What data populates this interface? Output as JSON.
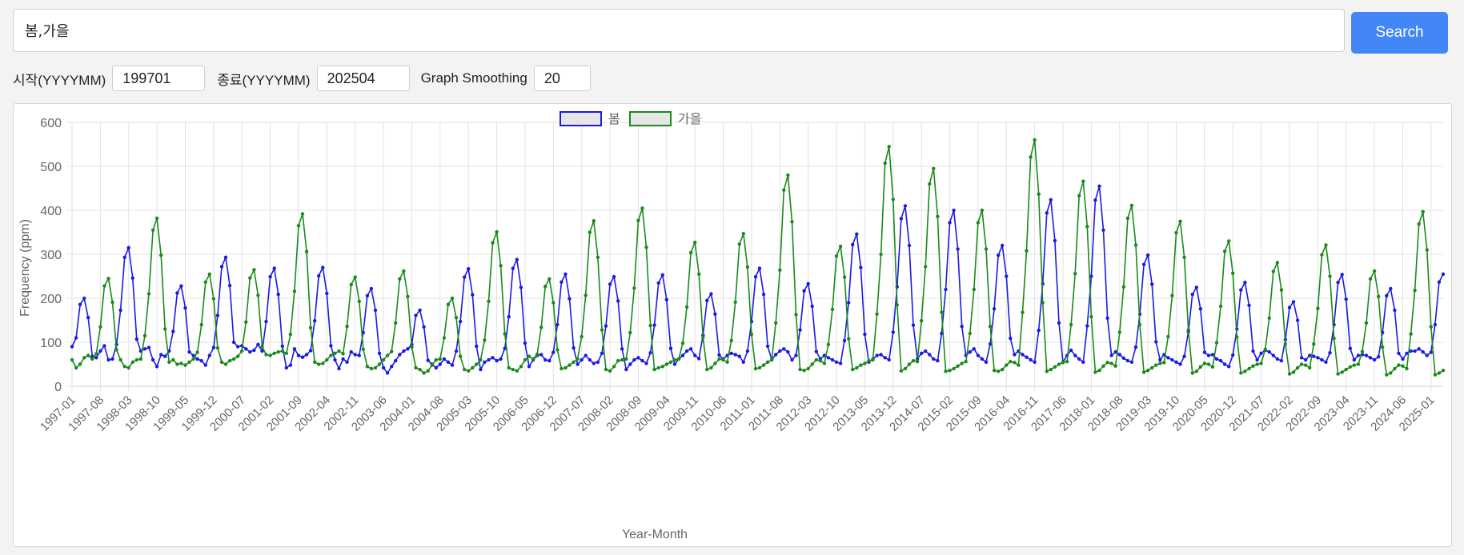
{
  "search": {
    "query": "봄,가을",
    "button_label": "Search"
  },
  "params": {
    "start_label": "시작(YYYYMM)",
    "start_value": "199701",
    "end_label": "종료(YYYYMM)",
    "end_value": "202504",
    "smoothing_label": "Graph Smoothing",
    "smoothing_value": "20"
  },
  "chart_data": {
    "type": "line",
    "xlabel": "Year-Month",
    "ylabel": "Frequency (ppm)",
    "ylim": [
      0,
      600
    ],
    "yticks": [
      0,
      100,
      200,
      300,
      400,
      500,
      600
    ],
    "grid": true,
    "legend_position": "top-center",
    "start": "1997-01",
    "tick_labels": [
      "1997-01",
      "1997-08",
      "1998-03",
      "1998-10",
      "1999-05",
      "1999-12",
      "2000-07",
      "2001-02",
      "2001-09",
      "2002-04",
      "2002-11",
      "2003-06",
      "2004-01",
      "2004-08",
      "2005-03",
      "2005-10",
      "2006-05",
      "2006-12",
      "2007-07",
      "2008-02",
      "2008-09",
      "2009-04",
      "2009-11",
      "2010-06",
      "2011-01",
      "2011-08",
      "2012-03",
      "2012-10",
      "2013-05",
      "2013-12",
      "2014-07",
      "2015-02",
      "2015-09",
      "2016-04",
      "2016-11",
      "2017-06",
      "2018-01",
      "2018-08",
      "2019-03",
      "2019-10",
      "2020-05",
      "2020-12",
      "2021-07",
      "2022-02",
      "2022-09",
      "2023-04",
      "2023-11",
      "2024-06",
      "2025-01"
    ],
    "series": [
      {
        "name": "봄",
        "color": "#1a1ae6",
        "peaks": [
          [
            "1997-04",
            200
          ],
          [
            "1998-03",
            315
          ],
          [
            "1999-04",
            228
          ],
          [
            "2000-03",
            293
          ],
          [
            "2001-03",
            268
          ],
          [
            "2002-03",
            270
          ],
          [
            "2003-03",
            222
          ],
          [
            "2004-03",
            173
          ],
          [
            "2005-03",
            267
          ],
          [
            "2006-03",
            288
          ],
          [
            "2007-03",
            255
          ],
          [
            "2008-03",
            249
          ],
          [
            "2009-03",
            253
          ],
          [
            "2010-03",
            210
          ],
          [
            "2011-03",
            268
          ],
          [
            "2012-03",
            233
          ],
          [
            "2013-03",
            346
          ],
          [
            "2014-03",
            410
          ],
          [
            "2015-03",
            400
          ],
          [
            "2016-03",
            320
          ],
          [
            "2017-03",
            424
          ],
          [
            "2018-03",
            455
          ],
          [
            "2019-03",
            298
          ],
          [
            "2020-03",
            225
          ],
          [
            "2021-03",
            236
          ],
          [
            "2022-03",
            192
          ],
          [
            "2023-03",
            254
          ],
          [
            "2024-03",
            222
          ],
          [
            "2025-04",
            255
          ]
        ],
        "base": [
          90,
          85,
          70,
          55,
          78,
          60,
          65,
          80,
          92,
          60,
          62,
          75,
          90,
          85,
          70,
          55,
          58,
          80,
          85,
          88,
          60,
          45,
          72,
          68,
          80,
          52,
          65,
          48,
          90,
          72,
          70,
          62,
          58,
          48,
          70,
          75,
          62,
          70,
          78,
          80,
          85,
          90,
          92,
          85,
          78,
          82,
          95,
          80,
          70,
          75,
          62,
          50,
          55,
          42,
          48,
          85,
          70,
          66,
          72,
          80,
          88,
          90,
          70,
          65,
          52,
          60,
          40,
          62,
          55,
          78,
          72,
          70,
          80,
          62,
          58,
          50,
          35,
          42,
          30,
          45,
          58,
          72,
          80,
          85,
          90,
          85,
          70,
          60,
          55,
          50,
          42,
          50,
          62,
          55,
          48,
          50,
          60,
          70,
          52,
          40,
          35,
          38,
          55,
          60,
          65,
          58,
          62,
          75,
          70,
          62,
          55,
          48,
          52,
          45,
          60,
          70,
          72,
          60,
          58,
          50,
          55,
          42,
          38,
          28,
          40,
          50,
          60,
          70,
          60,
          52,
          55,
          68,
          45,
          40,
          48,
          35,
          25,
          38,
          50,
          60,
          65,
          58,
          52,
          60,
          55,
          60,
          45,
          38,
          35,
          50,
          62,
          70,
          80,
          85,
          70,
          62,
          50,
          45,
          42,
          48,
          55,
          62,
          70,
          75,
          72,
          68,
          55,
          50,
          48,
          42,
          38,
          35,
          50,
          60,
          72,
          80,
          85,
          78,
          60,
          62,
          50,
          45,
          40,
          42,
          55,
          62,
          70,
          65,
          60,
          55,
          52,
          60,
          48,
          40,
          38,
          30,
          40,
          55,
          62,
          70,
          72,
          65,
          60,
          58,
          50,
          45,
          42,
          38,
          50,
          62,
          75,
          80,
          72,
          62,
          58,
          55,
          45,
          40,
          35,
          42,
          55,
          70,
          78,
          85,
          70,
          62,
          55,
          50,
          42,
          38,
          34,
          42,
          58,
          72,
          80,
          72,
          66,
          60,
          55,
          50,
          40,
          35,
          30,
          25,
          38,
          55,
          70,
          82,
          70,
          62,
          55,
          48,
          45,
          40,
          38,
          50,
          62,
          70,
          78,
          72,
          64,
          58,
          55,
          50,
          42,
          35,
          30,
          38,
          52,
          60,
          72,
          65,
          60,
          55,
          50,
          48,
          45,
          38,
          33,
          40,
          55,
          70,
          72,
          62,
          58,
          50,
          45,
          45,
          40,
          35,
          25,
          28,
          40,
          60,
          75,
          82,
          78,
          70,
          62,
          55,
          50,
          42,
          38,
          32,
          45,
          60,
          70,
          68,
          65,
          60,
          55,
          50,
          42,
          38,
          30,
          35,
          48,
          60,
          70,
          72,
          70,
          65,
          60,
          55,
          50,
          45,
          40,
          38,
          45,
          62,
          75,
          80,
          80,
          85,
          78,
          70,
          60,
          55,
          50,
          42,
          38,
          45,
          58,
          70,
          80,
          85,
          100
        ]
      },
      {
        "name": "가을",
        "color": "#1a8a1a",
        "peaks": [
          [
            "1997-10",
            245
          ],
          [
            "1998-10",
            382
          ],
          [
            "1999-11",
            255
          ],
          [
            "2000-10",
            265
          ],
          [
            "2001-10",
            392
          ],
          [
            "2002-11",
            248
          ],
          [
            "2003-11",
            262
          ],
          [
            "2004-11",
            200
          ],
          [
            "2005-10",
            351
          ],
          [
            "2006-11",
            244
          ],
          [
            "2007-10",
            376
          ],
          [
            "2008-10",
            405
          ],
          [
            "2009-11",
            327
          ],
          [
            "2010-11",
            347
          ],
          [
            "2011-10",
            480
          ],
          [
            "2012-11",
            318
          ],
          [
            "2013-11",
            545
          ],
          [
            "2014-10",
            495
          ],
          [
            "2015-10",
            400
          ],
          [
            "2016-11",
            560
          ],
          [
            "2017-11",
            466
          ],
          [
            "2018-11",
            411
          ],
          [
            "2019-11",
            375
          ],
          [
            "2020-11",
            330
          ],
          [
            "2021-11",
            281
          ],
          [
            "2022-11",
            321
          ],
          [
            "2023-11",
            262
          ],
          [
            "2024-11",
            397
          ]
        ],
        "base": [
          60,
          42,
          50,
          65,
          70,
          62,
          58,
          60,
          75,
          88,
          70,
          58,
          60,
          45,
          42,
          55,
          60,
          62,
          58,
          55,
          62,
          80,
          70,
          60,
          55,
          60,
          50,
          52,
          48,
          55,
          62,
          70,
          75,
          80,
          65,
          60,
          60,
          55,
          50,
          58,
          62,
          68,
          72,
          78,
          85,
          90,
          88,
          80,
          72,
          70,
          75,
          78,
          80,
          75,
          70,
          72,
          80,
          85,
          70,
          62,
          55,
          50,
          52,
          60,
          70,
          75,
          80,
          72,
          62,
          58,
          60,
          55,
          50,
          45,
          40,
          42,
          50,
          60,
          70,
          75,
          72,
          62,
          55,
          48,
          40,
          42,
          38,
          30,
          35,
          48,
          60,
          62,
          58,
          52,
          48,
          45,
          40,
          38,
          35,
          42,
          50,
          60,
          65,
          62,
          58,
          50,
          45,
          40,
          42,
          38,
          35,
          45,
          60,
          68,
          62,
          55,
          50,
          48,
          45,
          42,
          38,
          40,
          42,
          48,
          55,
          62,
          65,
          60,
          52,
          45,
          40,
          42,
          38,
          35,
          45,
          58,
          60,
          62,
          55,
          50,
          48,
          46,
          42,
          40,
          38,
          42,
          45,
          50,
          55,
          60,
          62,
          55,
          50,
          48,
          45,
          42,
          40,
          38,
          42,
          52,
          62,
          60,
          55,
          50,
          48,
          44,
          42,
          40,
          38,
          40,
          42,
          48,
          55,
          60,
          62,
          58,
          52,
          48,
          44,
          40,
          38,
          36,
          40,
          50,
          60,
          58,
          52,
          48,
          45,
          42,
          40,
          38,
          36,
          38,
          42,
          48,
          52,
          58,
          60,
          55,
          50,
          46,
          42,
          40,
          38,
          35,
          40,
          50,
          58,
          56,
          50,
          46,
          44,
          40,
          38,
          36,
          34,
          36,
          40,
          46,
          52,
          56,
          58,
          54,
          48,
          44,
          40,
          38,
          36,
          34,
          38,
          48,
          56,
          54,
          48,
          44,
          42,
          38,
          36,
          34,
          32,
          34,
          38,
          44,
          50,
          54,
          56,
          52,
          46,
          42,
          40,
          36,
          34,
          32,
          36,
          46,
          54,
          52,
          46,
          42,
          40,
          36,
          34,
          32,
          30,
          32,
          36,
          42,
          48,
          52,
          54,
          50,
          44,
          40,
          38,
          34,
          32,
          30,
          34,
          44,
          52,
          50,
          44,
          40,
          38,
          34,
          32,
          30,
          28,
          30,
          34,
          40,
          46,
          50,
          52,
          48,
          42,
          38,
          36,
          32,
          30,
          28,
          32,
          42,
          50,
          48,
          42,
          38,
          36,
          32,
          30,
          28,
          26,
          28,
          32,
          38,
          44,
          48,
          50,
          46,
          40,
          36,
          34,
          30,
          28,
          26,
          30,
          40,
          48,
          46,
          40,
          36,
          34,
          30,
          28,
          26,
          24,
          26,
          30,
          36,
          42,
          46,
          48
        ]
      }
    ]
  }
}
